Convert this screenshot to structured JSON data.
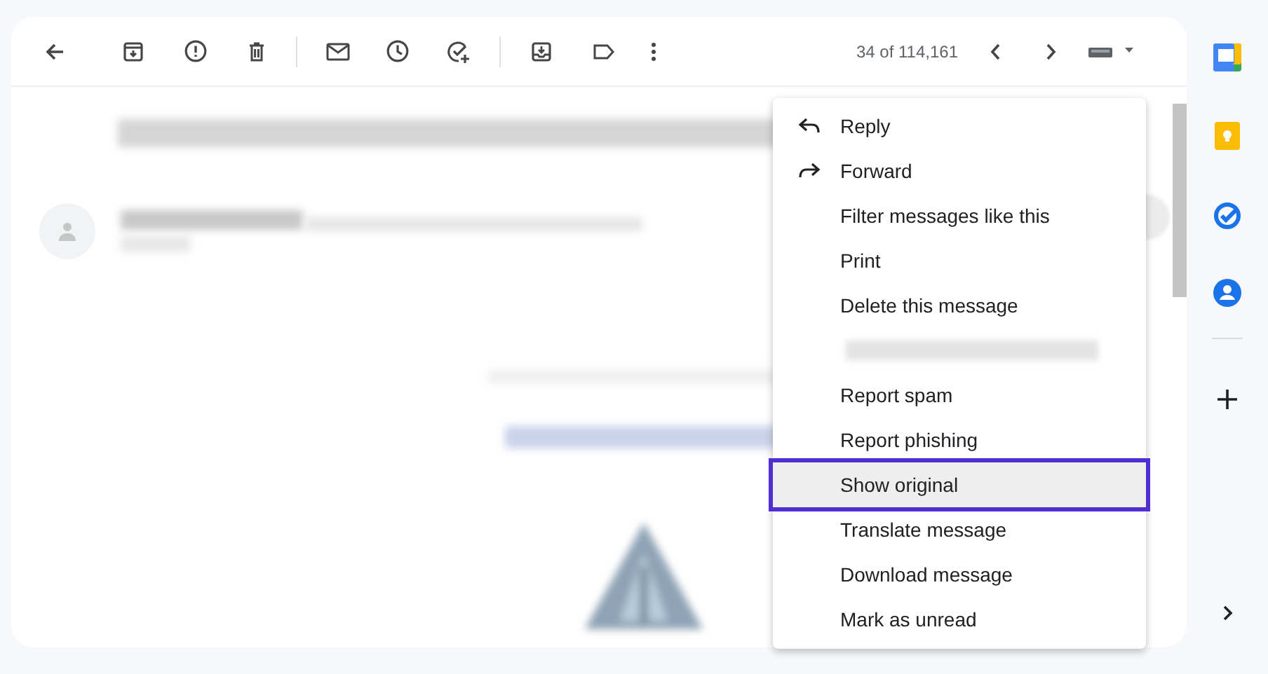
{
  "toolbar": {
    "counter": "34 of 114,161"
  },
  "menu": {
    "items": [
      {
        "kind": "reply",
        "label": "Reply",
        "selected": false
      },
      {
        "kind": "forward",
        "label": "Forward",
        "selected": false
      },
      {
        "kind": "item",
        "label": "Filter messages like this",
        "selected": false
      },
      {
        "kind": "item",
        "label": "Print",
        "selected": false
      },
      {
        "kind": "item",
        "label": "Delete this message",
        "selected": false
      },
      {
        "kind": "redacted"
      },
      {
        "kind": "item",
        "label": "Report spam",
        "selected": false
      },
      {
        "kind": "item",
        "label": "Report phishing",
        "selected": false
      },
      {
        "kind": "item",
        "label": "Show original",
        "selected": true
      },
      {
        "kind": "item",
        "label": "Translate message",
        "selected": false
      },
      {
        "kind": "item",
        "label": "Download message",
        "selected": false
      },
      {
        "kind": "item",
        "label": "Mark as unread",
        "selected": false
      }
    ]
  }
}
